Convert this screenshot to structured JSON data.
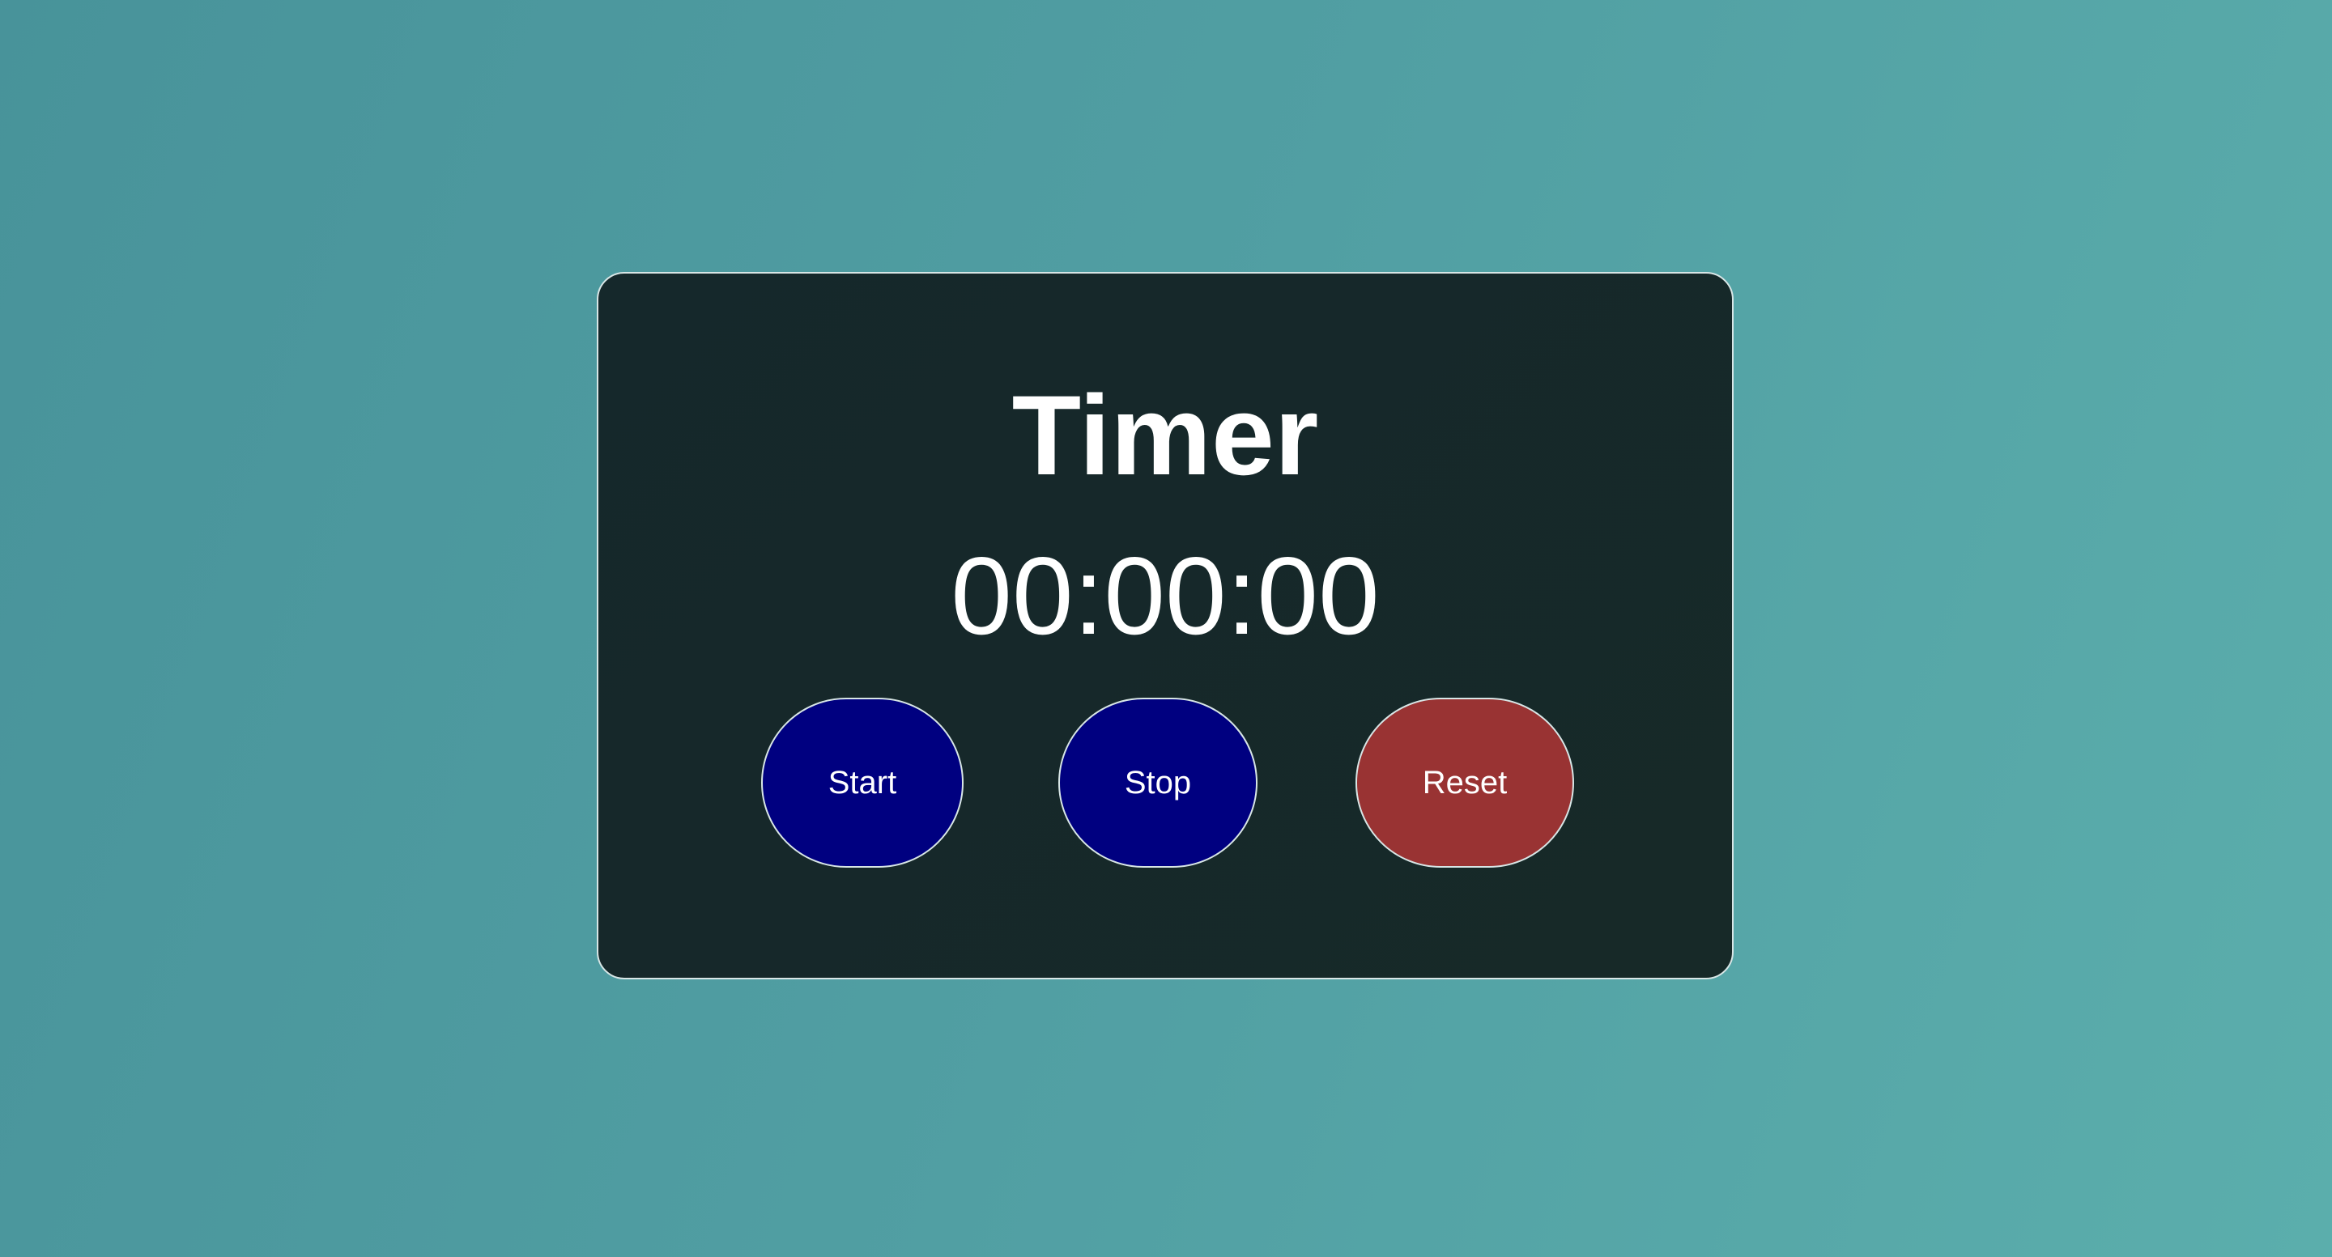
{
  "timer": {
    "title": "Timer",
    "display": "00:00:00"
  },
  "controls": {
    "start_label": "Start",
    "stop_label": "Stop",
    "reset_label": "Reset"
  },
  "colors": {
    "start": "#000080",
    "stop": "#000080",
    "reset": "#993333"
  }
}
